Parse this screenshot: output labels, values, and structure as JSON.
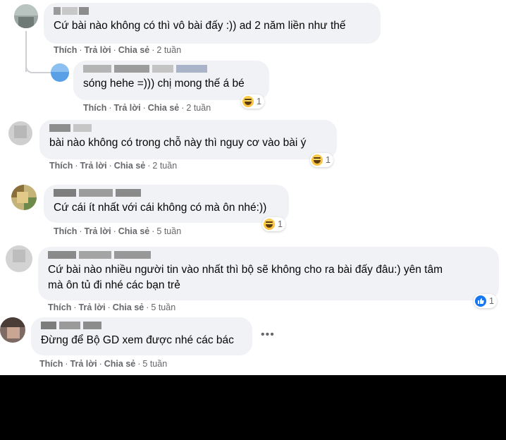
{
  "comments": [
    {
      "text": "Cứ bài nào không có thì vô bài đấy :)) ad 2 năm liền như thế",
      "actions": {
        "like": "Thích",
        "reply": "Trả lời",
        "share": "Chia sẻ",
        "time": "2 tuần"
      },
      "reaction": null
    },
    {
      "text": "sóng hehe =))) chị mong thế á bé",
      "actions": {
        "like": "Thích",
        "reply": "Trả lời",
        "share": "Chia sẻ",
        "time": "2 tuần"
      },
      "reaction": {
        "icon": "haha-reaction-icon",
        "count": "1"
      }
    },
    {
      "text": "bài nào không có trong chỗ này thì nguy cơ vào bài ý",
      "actions": {
        "like": "Thích",
        "reply": "Trả lời",
        "share": "Chia sẻ",
        "time": "2 tuần"
      },
      "reaction": {
        "icon": "haha-reaction-icon",
        "count": "1"
      }
    },
    {
      "text": "Cứ cái ít nhất với cái không có mà ôn nhé:))",
      "actions": {
        "like": "Thích",
        "reply": "Trả lời",
        "share": "Chia sẻ",
        "time": "5 tuần"
      },
      "reaction": {
        "icon": "haha-reaction-icon",
        "count": "1"
      }
    },
    {
      "text": "Cứ bài nào nhiều người tin vào nhất thì bộ sẽ không cho ra bài đấy đâu:) yên tâm\nmà ôn tủ đi nhé các bạn trẻ",
      "actions": {
        "like": "Thích",
        "reply": "Trả lời",
        "share": "Chia sẻ",
        "time": "5 tuần"
      },
      "reaction": {
        "icon": "like-reaction-icon",
        "count": "1"
      }
    },
    {
      "text": "Đừng để Bộ GD xem được nhé các bác",
      "actions": {
        "like": "Thích",
        "reply": "Trả lời",
        "share": "Chia sẻ",
        "time": "5 tuần"
      },
      "reaction": null
    }
  ],
  "more_icon": "ellipsis-icon",
  "colors": {
    "bubble": "#f0f2f5",
    "meta": "#65676b",
    "like_blue": "#1877f2",
    "haha_yellow": "#f7b125"
  }
}
